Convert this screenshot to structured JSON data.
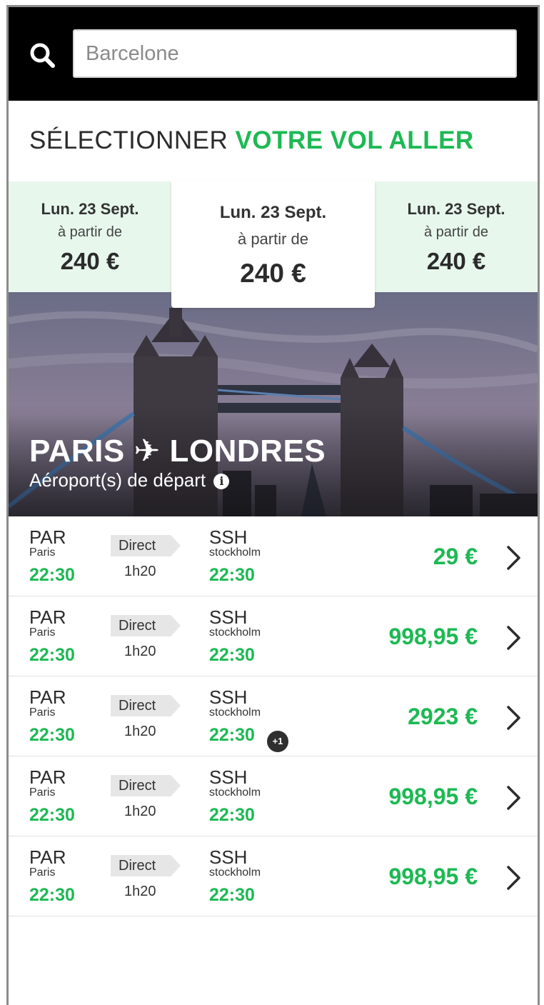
{
  "search": {
    "placeholder": "Barcelone"
  },
  "section": {
    "title_prefix": "SÉLECTIONNER ",
    "title_accent": "VOTRE VOL ALLER"
  },
  "dates": [
    {
      "date": "Lun. 23 Sept.",
      "from": "à partir de",
      "price": "240 €"
    },
    {
      "date": "Lun. 23 Sept.",
      "from": "à partir de",
      "price": "240 €"
    },
    {
      "date": "Lun. 23 Sept.",
      "from": "à partir de",
      "price": "240 €"
    }
  ],
  "hero": {
    "route": "PARIS ✈ LONDRES",
    "subtitle": "Aéroport(s) de départ",
    "info_icon": "i"
  },
  "flights": [
    {
      "dep_code": "PAR",
      "dep_city": "Paris",
      "dep_time": "22:30",
      "tag": "Direct",
      "duration": "1h20",
      "arr_code": "SSH",
      "arr_city": "stockholm",
      "arr_time": "22:30",
      "price": "29 €"
    },
    {
      "dep_code": "PAR",
      "dep_city": "Paris",
      "dep_time": "22:30",
      "tag": "Direct",
      "duration": "1h20",
      "arr_code": "SSH",
      "arr_city": "stockholm",
      "arr_time": "22:30",
      "price": "998,95 €"
    },
    {
      "dep_code": "PAR",
      "dep_city": "Paris",
      "dep_time": "22:30",
      "tag": "Direct",
      "duration": "1h20",
      "arr_code": "SSH",
      "arr_city": "stockholm",
      "arr_time": "22:30",
      "day_offset": "+1",
      "price": "2923 €"
    },
    {
      "dep_code": "PAR",
      "dep_city": "Paris",
      "dep_time": "22:30",
      "tag": "Direct",
      "duration": "1h20",
      "arr_code": "SSH",
      "arr_city": "stockholm",
      "arr_time": "22:30",
      "price": "998,95 €"
    },
    {
      "dep_code": "PAR",
      "dep_city": "Paris",
      "dep_time": "22:30",
      "tag": "Direct",
      "duration": "1h20",
      "arr_code": "SSH",
      "arr_city": "stockholm",
      "arr_time": "22:30",
      "price": "998,95 €"
    }
  ],
  "colors": {
    "accent": "#1db954",
    "date_tab_bg": "#e7f7ec",
    "topbar": "#000000"
  }
}
